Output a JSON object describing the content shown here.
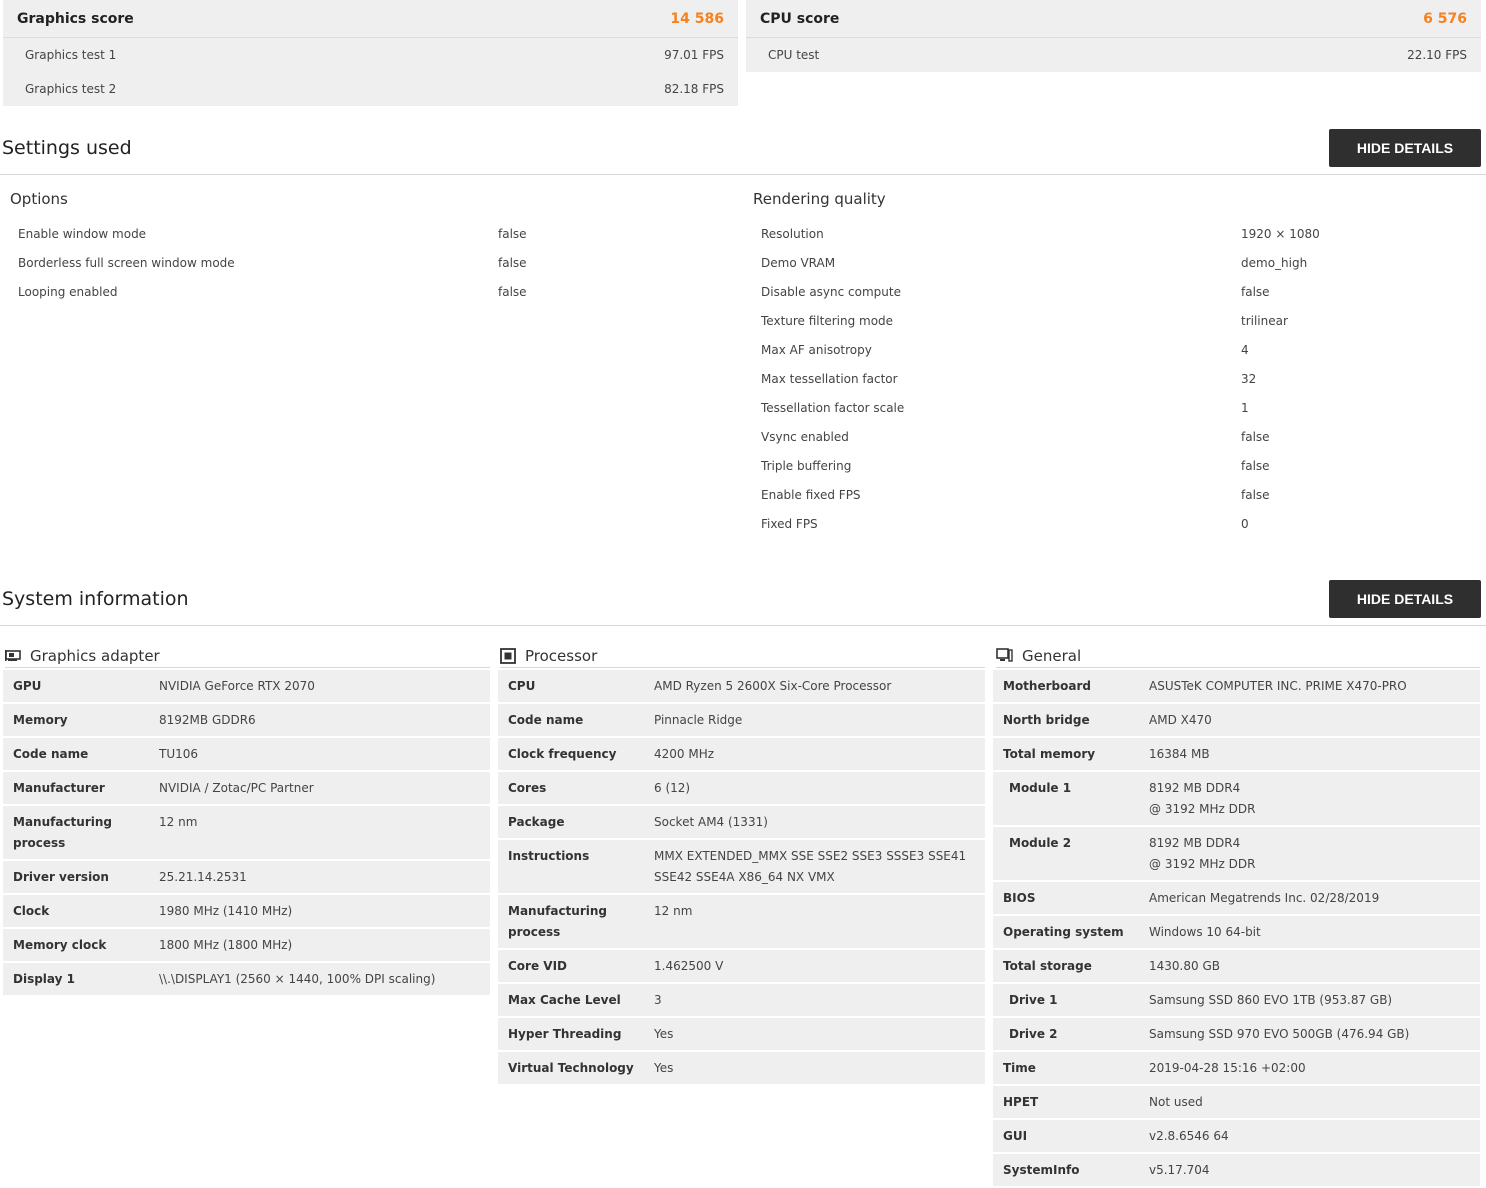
{
  "scores": {
    "graphics": {
      "title": "Graphics score",
      "value": "14 586",
      "tests": [
        {
          "name": "Graphics test 1",
          "value": "97.01 FPS"
        },
        {
          "name": "Graphics test 2",
          "value": "82.18 FPS"
        }
      ]
    },
    "cpu": {
      "title": "CPU score",
      "value": "6 576",
      "tests": [
        {
          "name": "CPU test",
          "value": "22.10 FPS"
        }
      ]
    }
  },
  "settings": {
    "title": "Settings used",
    "button": "HIDE DETAILS",
    "options": {
      "title": "Options",
      "rows": [
        {
          "k": "Enable window mode",
          "v": "false"
        },
        {
          "k": "Borderless full screen window mode",
          "v": "false"
        },
        {
          "k": "Looping enabled",
          "v": "false"
        }
      ]
    },
    "rendering": {
      "title": "Rendering quality",
      "rows": [
        {
          "k": "Resolution",
          "v": "1920 × 1080"
        },
        {
          "k": "Demo VRAM",
          "v": "demo_high"
        },
        {
          "k": "Disable async compute",
          "v": "false"
        },
        {
          "k": "Texture filtering mode",
          "v": "trilinear"
        },
        {
          "k": "Max AF anisotropy",
          "v": "4"
        },
        {
          "k": "Max tessellation factor",
          "v": "32"
        },
        {
          "k": "Tessellation factor scale",
          "v": "1"
        },
        {
          "k": "Vsync enabled",
          "v": "false"
        },
        {
          "k": "Triple buffering",
          "v": "false"
        },
        {
          "k": "Enable fixed FPS",
          "v": "false"
        },
        {
          "k": "Fixed FPS",
          "v": "0"
        }
      ]
    }
  },
  "sysinfo": {
    "title": "System information",
    "button": "HIDE DETAILS",
    "graphics": {
      "title": "Graphics adapter",
      "icon": "graphics-card-icon",
      "rows": [
        {
          "k": "GPU",
          "v": "NVIDIA GeForce RTX 2070"
        },
        {
          "k": "Memory",
          "v": "8192MB GDDR6"
        },
        {
          "k": "Code name",
          "v": "TU106"
        },
        {
          "k": "Manufacturer",
          "v": "NVIDIA / Zotac/PC Partner"
        },
        {
          "k": "Manufacturing process",
          "v": "12 nm"
        },
        {
          "k": "Driver version",
          "v": "25.21.14.2531"
        },
        {
          "k": "Clock",
          "v": "1980 MHz (1410 MHz)"
        },
        {
          "k": "Memory clock",
          "v": "1800 MHz (1800 MHz)"
        },
        {
          "k": "Display 1",
          "v": "\\\\.\\DISPLAY1 (2560 × 1440, 100% DPI scaling)"
        }
      ]
    },
    "processor": {
      "title": "Processor",
      "icon": "cpu-chip-icon",
      "rows": [
        {
          "k": "CPU",
          "v": "AMD Ryzen 5 2600X Six-Core Processor"
        },
        {
          "k": "Code name",
          "v": "Pinnacle Ridge"
        },
        {
          "k": "Clock frequency",
          "v": "4200 MHz"
        },
        {
          "k": "Cores",
          "v": "6 (12)"
        },
        {
          "k": "Package",
          "v": "Socket AM4 (1331)"
        },
        {
          "k": "Instructions",
          "v": "MMX EXTENDED_MMX SSE SSE2 SSE3 SSSE3 SSE41 SSE42 SSE4A X86_64 NX VMX"
        },
        {
          "k": "Manufacturing process",
          "v": "12 nm"
        },
        {
          "k": "Core VID",
          "v": "1.462500 V"
        },
        {
          "k": "Max Cache Level",
          "v": "3"
        },
        {
          "k": "Hyper Threading",
          "v": "Yes"
        },
        {
          "k": "Virtual Technology",
          "v": "Yes"
        }
      ]
    },
    "general": {
      "title": "General",
      "icon": "computer-monitor-icon",
      "rows": [
        {
          "k": "Motherboard",
          "v": "ASUSTeK COMPUTER INC. PRIME X470-PRO"
        },
        {
          "k": "North bridge",
          "v": "AMD X470"
        },
        {
          "k": "Total memory",
          "v": "16384 MB"
        },
        {
          "k": "Module 1",
          "v": "8192 MB DDR4",
          "v2": "@ 3192 MHz DDR",
          "sub": true
        },
        {
          "k": "Module 2",
          "v": "8192 MB DDR4",
          "v2": "@ 3192 MHz DDR",
          "sub": true
        },
        {
          "k": "BIOS",
          "v": "American Megatrends Inc. 02/28/2019"
        },
        {
          "k": "Operating system",
          "v": "Windows 10 64-bit"
        },
        {
          "k": "Total storage",
          "v": "1430.80 GB"
        },
        {
          "k": "Drive 1",
          "v": "Samsung SSD 860 EVO 1TB (953.87 GB)",
          "sub": true
        },
        {
          "k": "Drive 2",
          "v": "Samsung SSD 970 EVO 500GB (476.94 GB)",
          "sub": true
        },
        {
          "k": "Time",
          "v": "2019-04-28 15:16 +02:00"
        },
        {
          "k": "HPET",
          "v": "Not used"
        },
        {
          "k": "GUI",
          "v": "v2.8.6546 64"
        },
        {
          "k": "SystemInfo",
          "v": "v5.17.704"
        }
      ]
    }
  }
}
